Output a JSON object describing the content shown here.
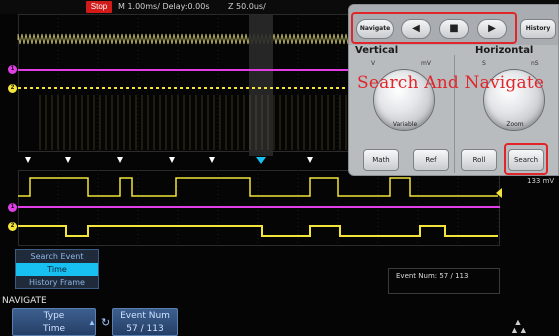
{
  "topbar": {
    "status": "Stop",
    "timebase": "M 1.00ms/ Delay:0.00s",
    "zoom": "Z 50.0us/"
  },
  "channels": {
    "ch1_marker": "1",
    "ch2_marker": "2",
    "ch1_color": "#e23ee6",
    "ch2_color": "#f2e43a"
  },
  "search_menu": {
    "items": [
      "Search Event",
      "Time",
      "History Frame"
    ],
    "selected": "Time"
  },
  "screen": {
    "event_num_text": "Event Num: 57 / 113",
    "scale_text": "133 mV"
  },
  "bottom_menu": {
    "title": "NAVIGATE",
    "type_key": {
      "label": "Type",
      "value": "Time"
    },
    "event_key": {
      "label": "Event Num",
      "value": "57 / 113"
    }
  },
  "panel": {
    "navigate_label": "Navigate",
    "history_label": "History",
    "prev_icon": "◀",
    "stop_icon": "■",
    "next_icon": "▶",
    "vertical_label": "Vertical",
    "horizontal_label": "Horizontal",
    "vertical_minus": "V",
    "vertical_plus": "mV",
    "horizontal_minus": "S",
    "horizontal_plus": "nS",
    "vertical_knob_label": "Variable",
    "horizontal_knob_label": "Zoom",
    "math_label": "Math",
    "ref_label": "Ref",
    "roll_label": "Roll",
    "search_label": "Search",
    "overlay_title": "Search And Navigate",
    "highlight_color": "#e0262a"
  },
  "colors": {
    "menu_active": "#17c0f0",
    "stop_red": "#d11a1a"
  }
}
